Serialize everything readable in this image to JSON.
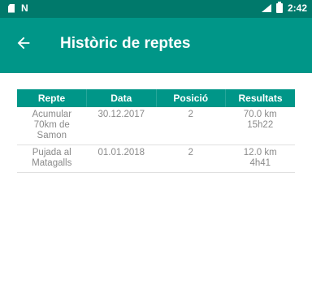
{
  "status_bar": {
    "left_icons": [
      "sd-card-icon",
      "n-notification-icon"
    ],
    "right_icons": [
      "signal-icon",
      "battery-icon"
    ],
    "time": "2:42"
  },
  "app_bar": {
    "back_icon": "arrow-back-icon",
    "title": "Històric de reptes"
  },
  "table": {
    "headers": [
      "Repte",
      "Data",
      "Posició",
      "Resultats"
    ],
    "rows": [
      {
        "repte": "Acumular\n70km de\nSamon",
        "data": "30.12.2017",
        "posicio": "2",
        "resultats": "70.0 km\n15h22"
      },
      {
        "repte": "Pujada al\nMatagalls",
        "data": "01.01.2018",
        "posicio": "2",
        "resultats": "12.0 km\n4h41"
      }
    ]
  },
  "colors": {
    "status_bar": "#00796b",
    "app_bar": "#009688",
    "header": "#009688",
    "cell_text": "#8a8a8a"
  }
}
